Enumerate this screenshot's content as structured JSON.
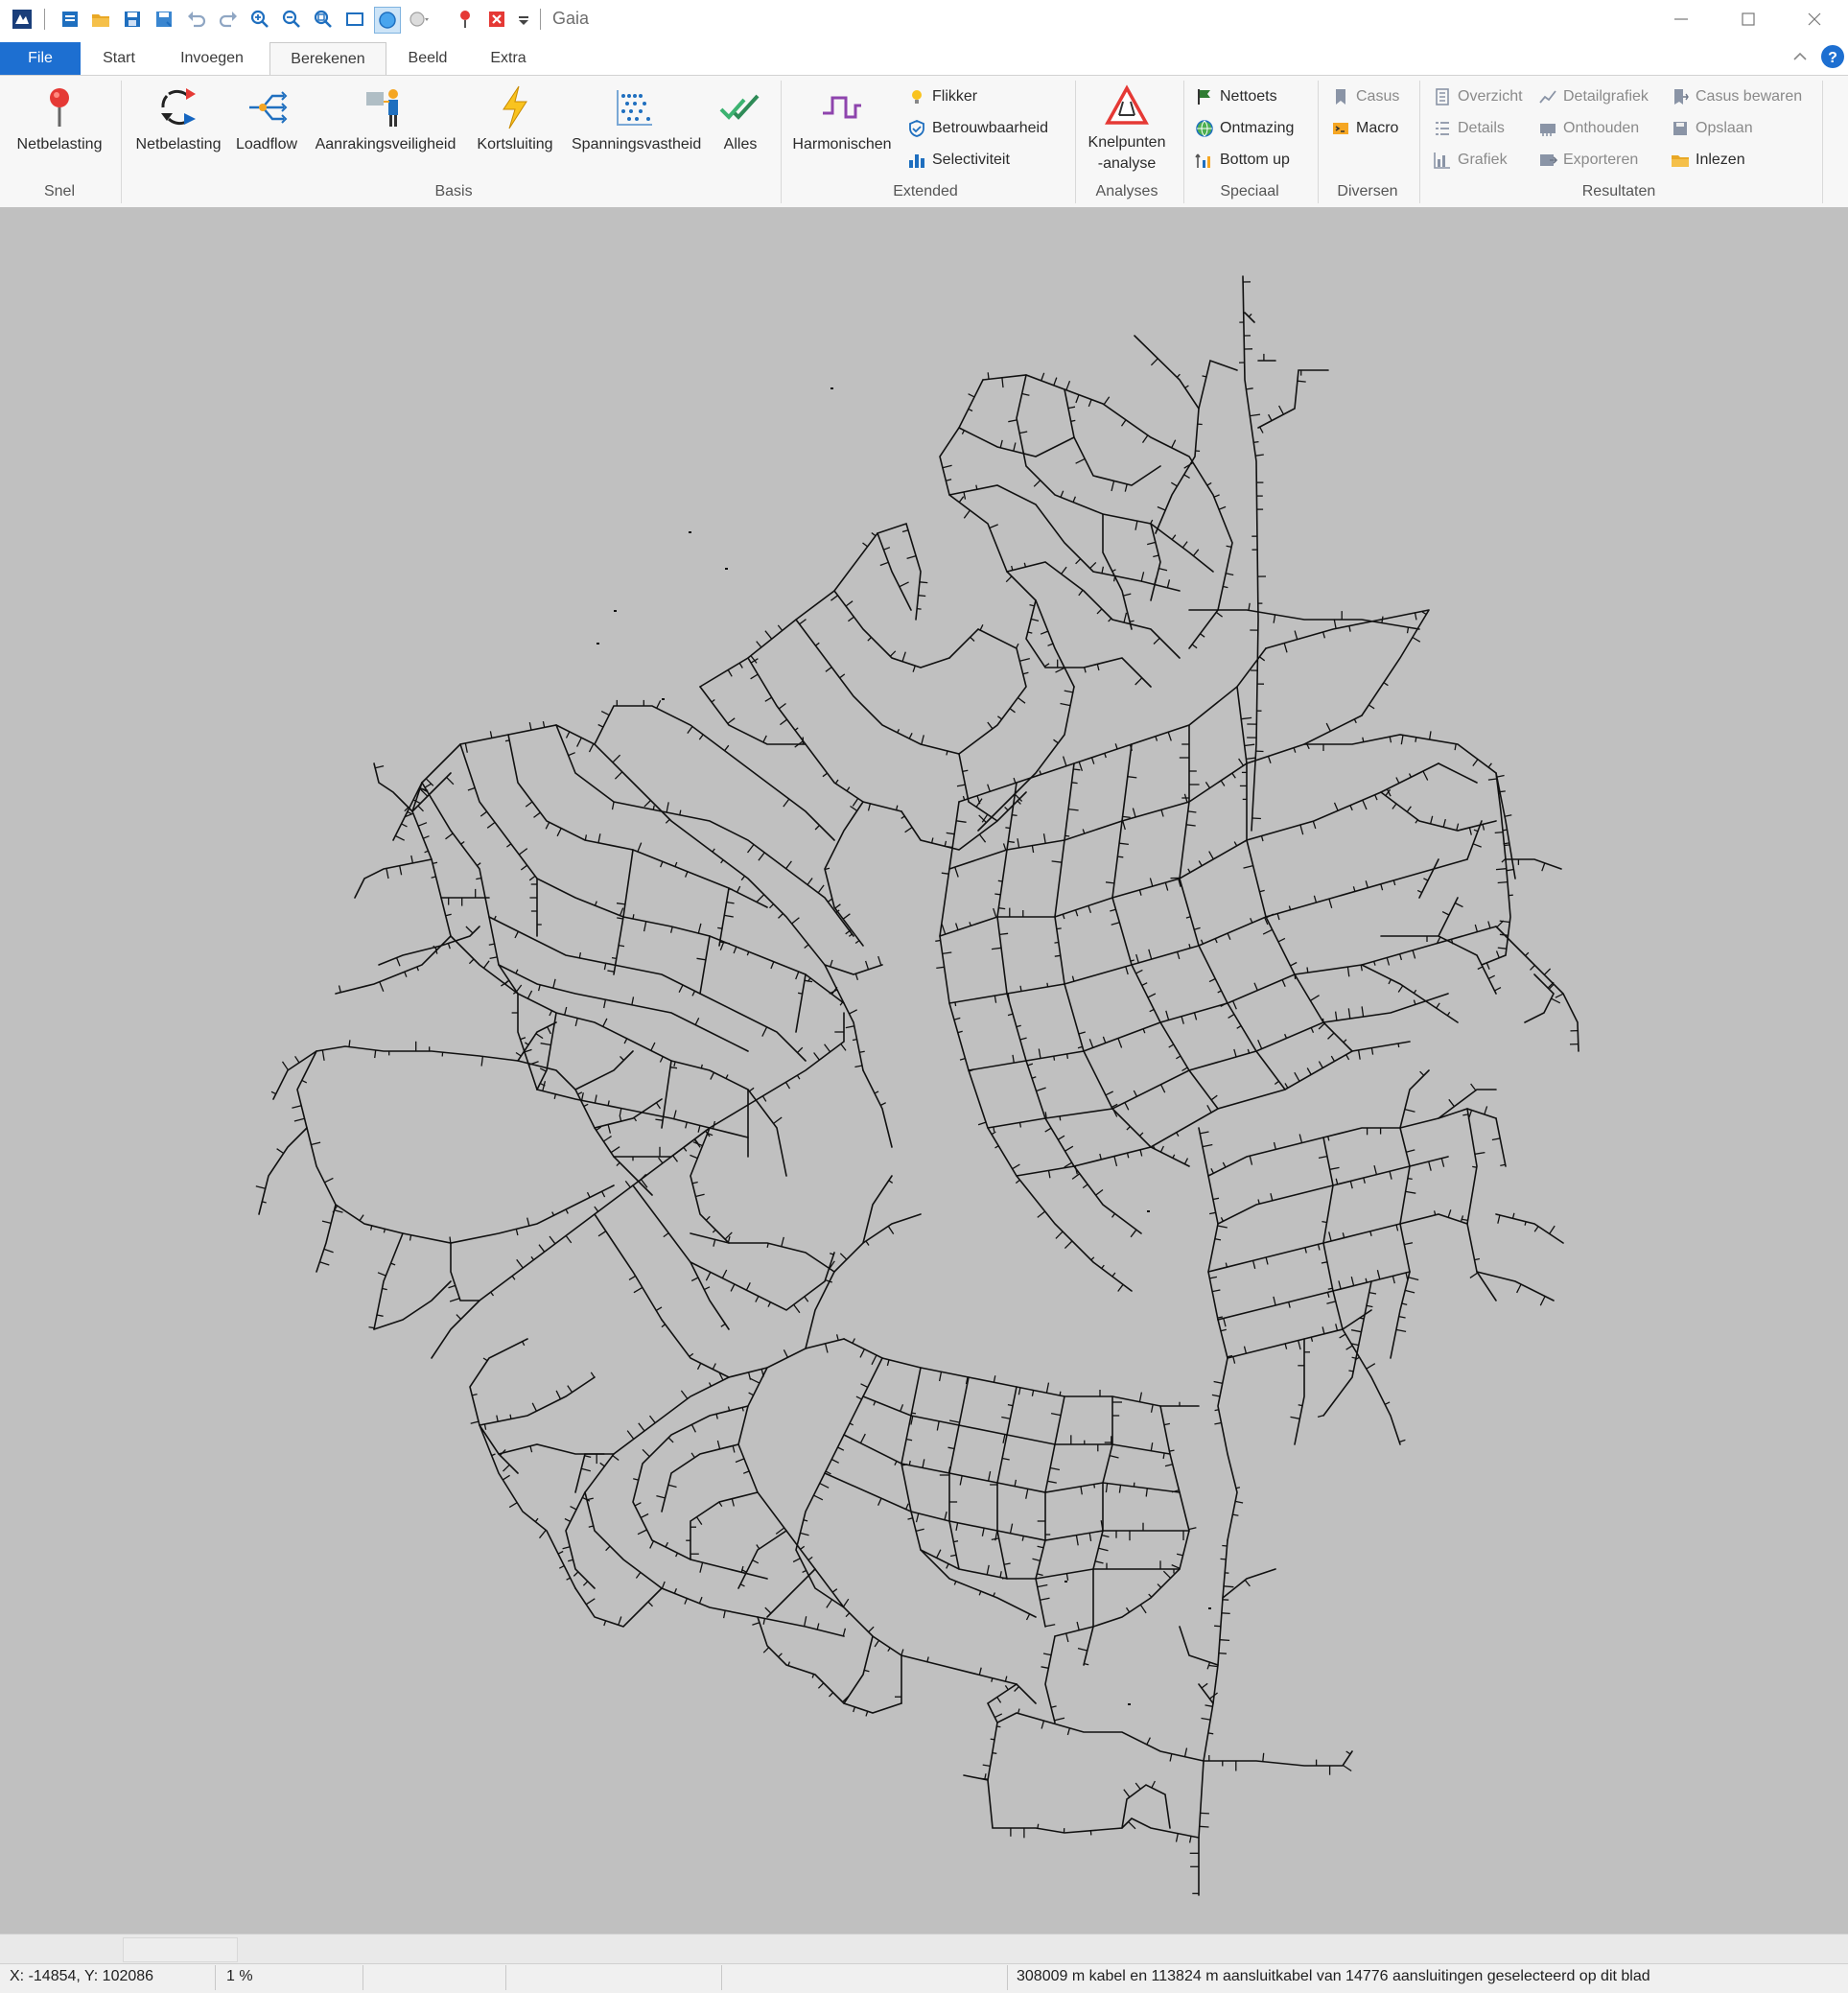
{
  "window": {
    "title": "Gaia"
  },
  "quick_access": {
    "icons": [
      "app-logo-icon",
      "new-icon",
      "open-folder-icon",
      "save-icon",
      "save-as-icon",
      "undo-icon",
      "redo-icon",
      "zoom-in-icon",
      "zoom-out-icon",
      "zoom-fit-icon",
      "rectangle-select-icon",
      "circle-select-icon",
      "circle-dropdown-icon",
      "pin-icon",
      "delete-icon",
      "customize-icon"
    ]
  },
  "tabs": [
    "File",
    "Start",
    "Invoegen",
    "Berekenen",
    "Beeld",
    "Extra"
  ],
  "ribbon": {
    "snel": {
      "label": "Snel",
      "netbelasting": "Netbelasting"
    },
    "basis": {
      "label": "Basis",
      "netbelasting": "Netbelasting",
      "loadflow": "Loadflow",
      "aanrakingsveiligheid": "Aanrakingsveiligheid",
      "kortsluiting": "Kortsluiting",
      "spanningsvastheid": "Spanningsvastheid",
      "alles": "Alles"
    },
    "extended": {
      "label": "Extended",
      "harmonischen": "Harmonischen",
      "flikker": "Flikker",
      "betrouwbaarheid": "Betrouwbaarheid",
      "selectiviteit": "Selectiviteit"
    },
    "analyses": {
      "label": "Analyses",
      "knelpunten_line1": "Knelpunten",
      "knelpunten_line2": "-analyse"
    },
    "speciaal": {
      "label": "Speciaal",
      "nettoets": "Nettoets",
      "ontmazing": "Ontmazing",
      "bottom_up": "Bottom up"
    },
    "diversen": {
      "label": "Diversen",
      "casus": "Casus",
      "macro": "Macro"
    },
    "resultaten": {
      "label": "Resultaten",
      "overzicht": "Overzicht",
      "details": "Details",
      "grafiek": "Grafiek",
      "detailgrafiek": "Detailgrafiek",
      "onthouden": "Onthouden",
      "exporteren": "Exporteren",
      "casus_bewaren": "Casus bewaren",
      "opslaan": "Opslaan",
      "inlezen": "Inlezen"
    }
  },
  "colors": {
    "file_tab": "#1d6fd1",
    "canvas": "#c0c0c0",
    "network_lines": "#111111"
  },
  "status": {
    "coordinates": "X: -14854, Y: 102086",
    "zoom": "1 %",
    "selection": "308009 m kabel en 113824 m aansluitkabel van 14776 aansluitingen geselecteerd op dit blad"
  }
}
